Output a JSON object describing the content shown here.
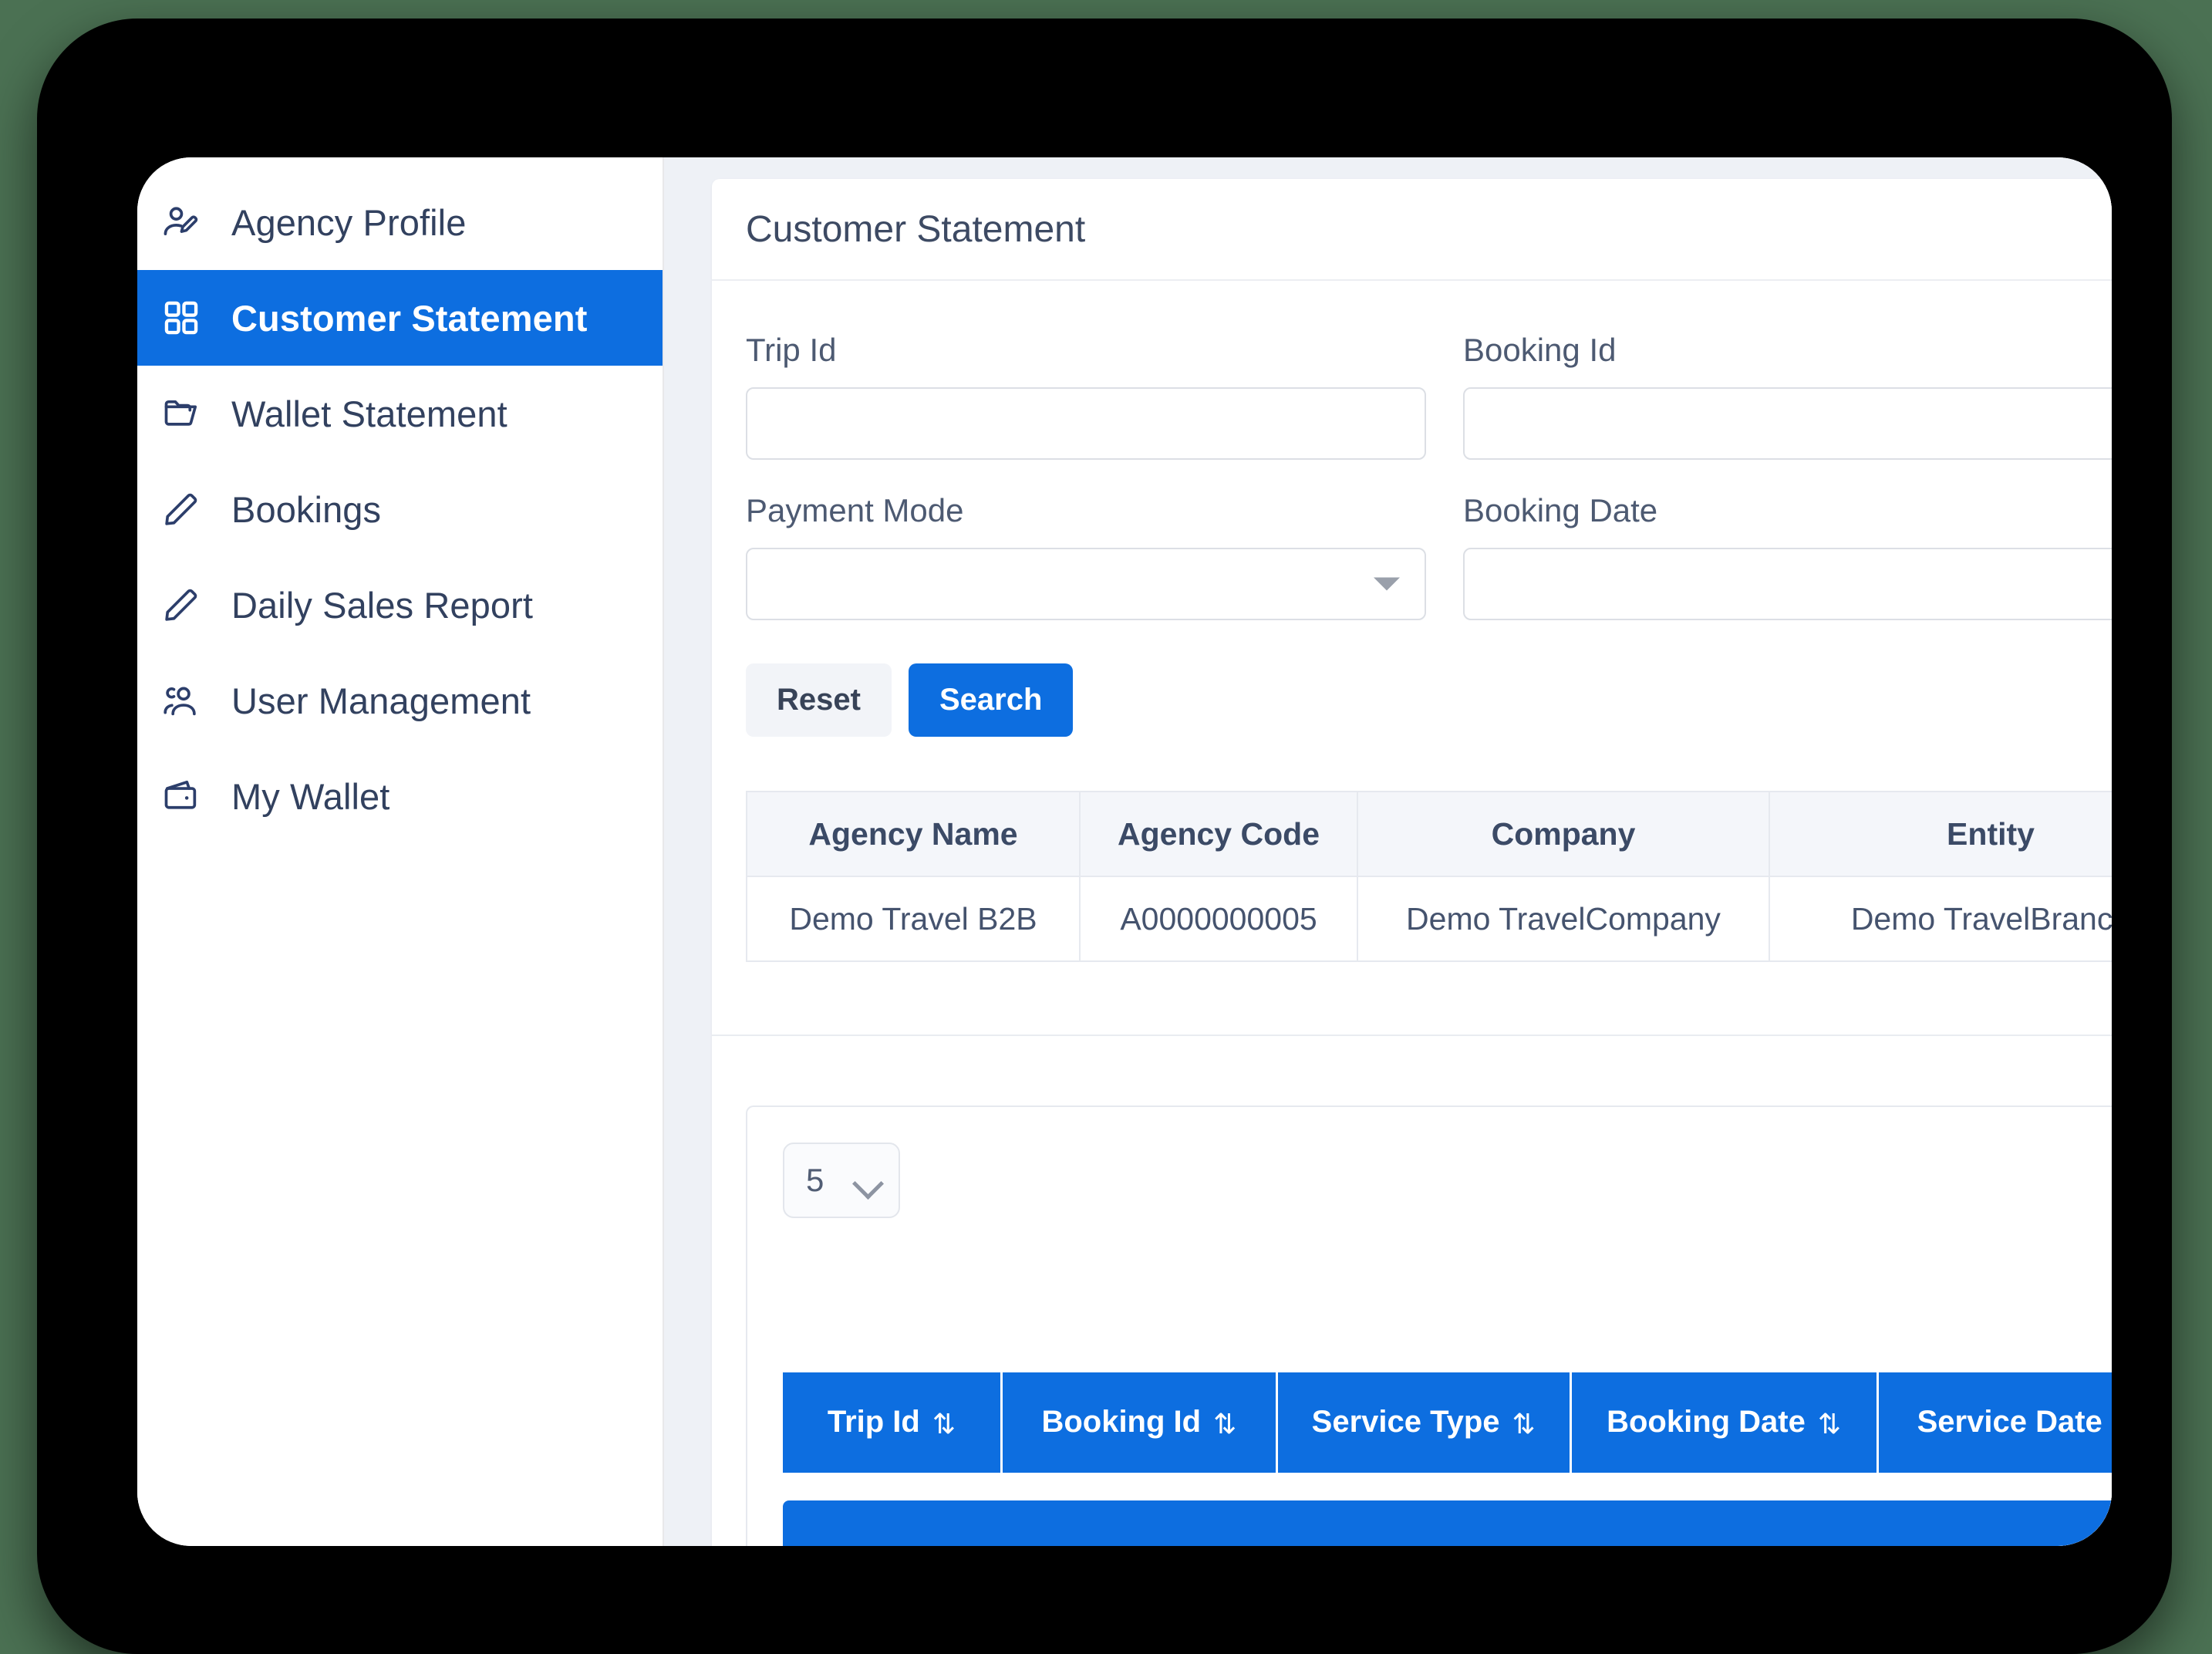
{
  "sidebar": {
    "items": [
      {
        "label": "Agency Profile",
        "icon": "user-edit-icon",
        "active": false
      },
      {
        "label": "Customer Statement",
        "icon": "grid-icon",
        "active": true
      },
      {
        "label": "Wallet Statement",
        "icon": "folder-open-icon",
        "active": false
      },
      {
        "label": "Bookings",
        "icon": "pencil-icon",
        "active": false
      },
      {
        "label": "Daily Sales Report",
        "icon": "pencil-icon",
        "active": false
      },
      {
        "label": "User Management",
        "icon": "users-icon",
        "active": false
      },
      {
        "label": "My Wallet",
        "icon": "wallet-icon",
        "active": false
      }
    ]
  },
  "card": {
    "title": "Customer Statement"
  },
  "filters": {
    "trip_id": {
      "label": "Trip Id",
      "value": "",
      "placeholder": ""
    },
    "booking_id": {
      "label": "Booking Id",
      "value": "",
      "placeholder": ""
    },
    "payment_mode": {
      "label": "Payment Mode",
      "value": "",
      "placeholder": "",
      "options": []
    },
    "booking_date": {
      "label": "Booking Date",
      "value": "",
      "placeholder": ""
    }
  },
  "actions": {
    "reset_label": "Reset",
    "search_label": "Search"
  },
  "agency_table": {
    "columns": [
      "Agency Name",
      "Agency Code",
      "Company",
      "Entity"
    ],
    "rows": [
      [
        "Demo Travel B2B",
        "A0000000005",
        "Demo TravelCompany",
        "Demo TravelBranch"
      ]
    ]
  },
  "results": {
    "page_size": "5",
    "columns": [
      {
        "label": "Trip Id",
        "sort": "⇅"
      },
      {
        "label": "Booking Id",
        "sort": "⇅"
      },
      {
        "label": "Service Type",
        "sort": "⇅"
      },
      {
        "label": "Booking Date",
        "sort": "⇅"
      },
      {
        "label": "Service Date",
        "sort": "⇅"
      }
    ],
    "rows": []
  },
  "colors": {
    "accent": "#0d6ee0",
    "text": "#32415f",
    "panel_bg": "#eef1f6",
    "desktop_bg": "#4b7153",
    "bezel": "#000000"
  }
}
